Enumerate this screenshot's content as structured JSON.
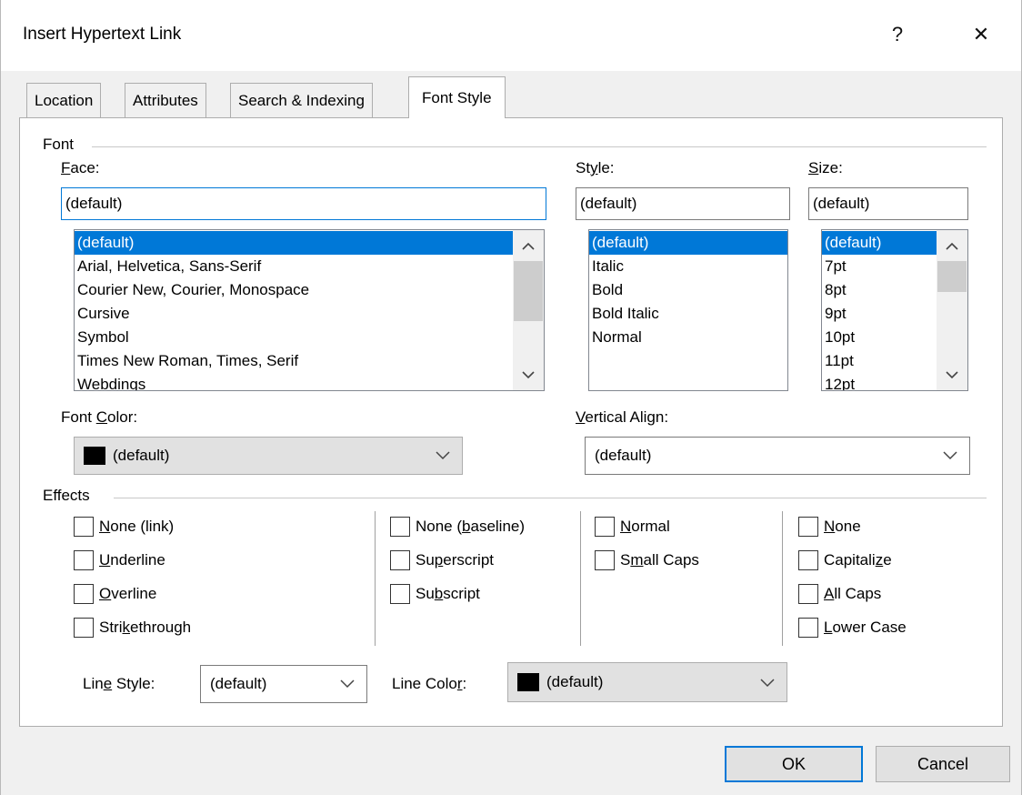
{
  "window": {
    "title": "Insert Hypertext Link",
    "help": "?",
    "close": "✕"
  },
  "tabs": [
    {
      "label": "Location"
    },
    {
      "label": "Attributes"
    },
    {
      "label": "Search & Indexing"
    },
    {
      "label": "Font Style"
    }
  ],
  "font_group": {
    "title": "Font",
    "face": {
      "label_u": "F",
      "label_rest": "ace:",
      "value": "(default)",
      "options": [
        "(default)",
        "Arial, Helvetica, Sans-Serif",
        "Courier New, Courier, Monospace",
        "Cursive",
        "Symbol",
        "Times New Roman, Times, Serif",
        "Webdings"
      ]
    },
    "style": {
      "label_pre": "St",
      "label_u": "y",
      "label_post": "le:",
      "value": "(default)",
      "options": [
        "(default)",
        "Italic",
        "Bold",
        "Bold Italic",
        "Normal"
      ]
    },
    "size": {
      "label_u": "S",
      "label_rest": "ize:",
      "value": "(default)",
      "options": [
        "(default)",
        "7pt",
        "8pt",
        "9pt",
        "10pt",
        "11pt",
        "12pt"
      ]
    },
    "font_color": {
      "label_pre": "Font ",
      "label_u": "C",
      "label_post": "olor:",
      "value": "(default)"
    },
    "vertical_align": {
      "label_u": "V",
      "label_rest": "ertical Align:",
      "value": "(default)"
    }
  },
  "effects_group": {
    "title": "Effects",
    "col1": [
      {
        "pre": "",
        "u": "N",
        "post": "one (link)"
      },
      {
        "pre": "",
        "u": "U",
        "post": "nderline"
      },
      {
        "pre": "",
        "u": "O",
        "post": "verline"
      },
      {
        "pre": "Stri",
        "u": "k",
        "post": "ethrough"
      }
    ],
    "col2": [
      {
        "pre": "None (",
        "u": "b",
        "post": "aseline)"
      },
      {
        "pre": "Su",
        "u": "p",
        "post": "erscript"
      },
      {
        "pre": "Su",
        "u": "b",
        "post": "script"
      }
    ],
    "col3": [
      {
        "pre": "",
        "u": "N",
        "post": "ormal"
      },
      {
        "pre": "S",
        "u": "m",
        "post": "all Caps"
      }
    ],
    "col4": [
      {
        "pre": "",
        "u": "N",
        "post": "one"
      },
      {
        "pre": "Capitali",
        "u": "z",
        "post": "e"
      },
      {
        "pre": "",
        "u": "A",
        "post": "ll Caps"
      },
      {
        "pre": "",
        "u": "L",
        "post": "ower Case"
      }
    ],
    "line_style": {
      "pre": "Lin",
      "u": "e",
      "post": " Style:",
      "value": "(default)"
    },
    "line_color": {
      "pre": "Line Colo",
      "u": "r",
      "post": ":",
      "value": "(default)"
    }
  },
  "buttons": {
    "ok": "OK",
    "cancel": "Cancel"
  }
}
